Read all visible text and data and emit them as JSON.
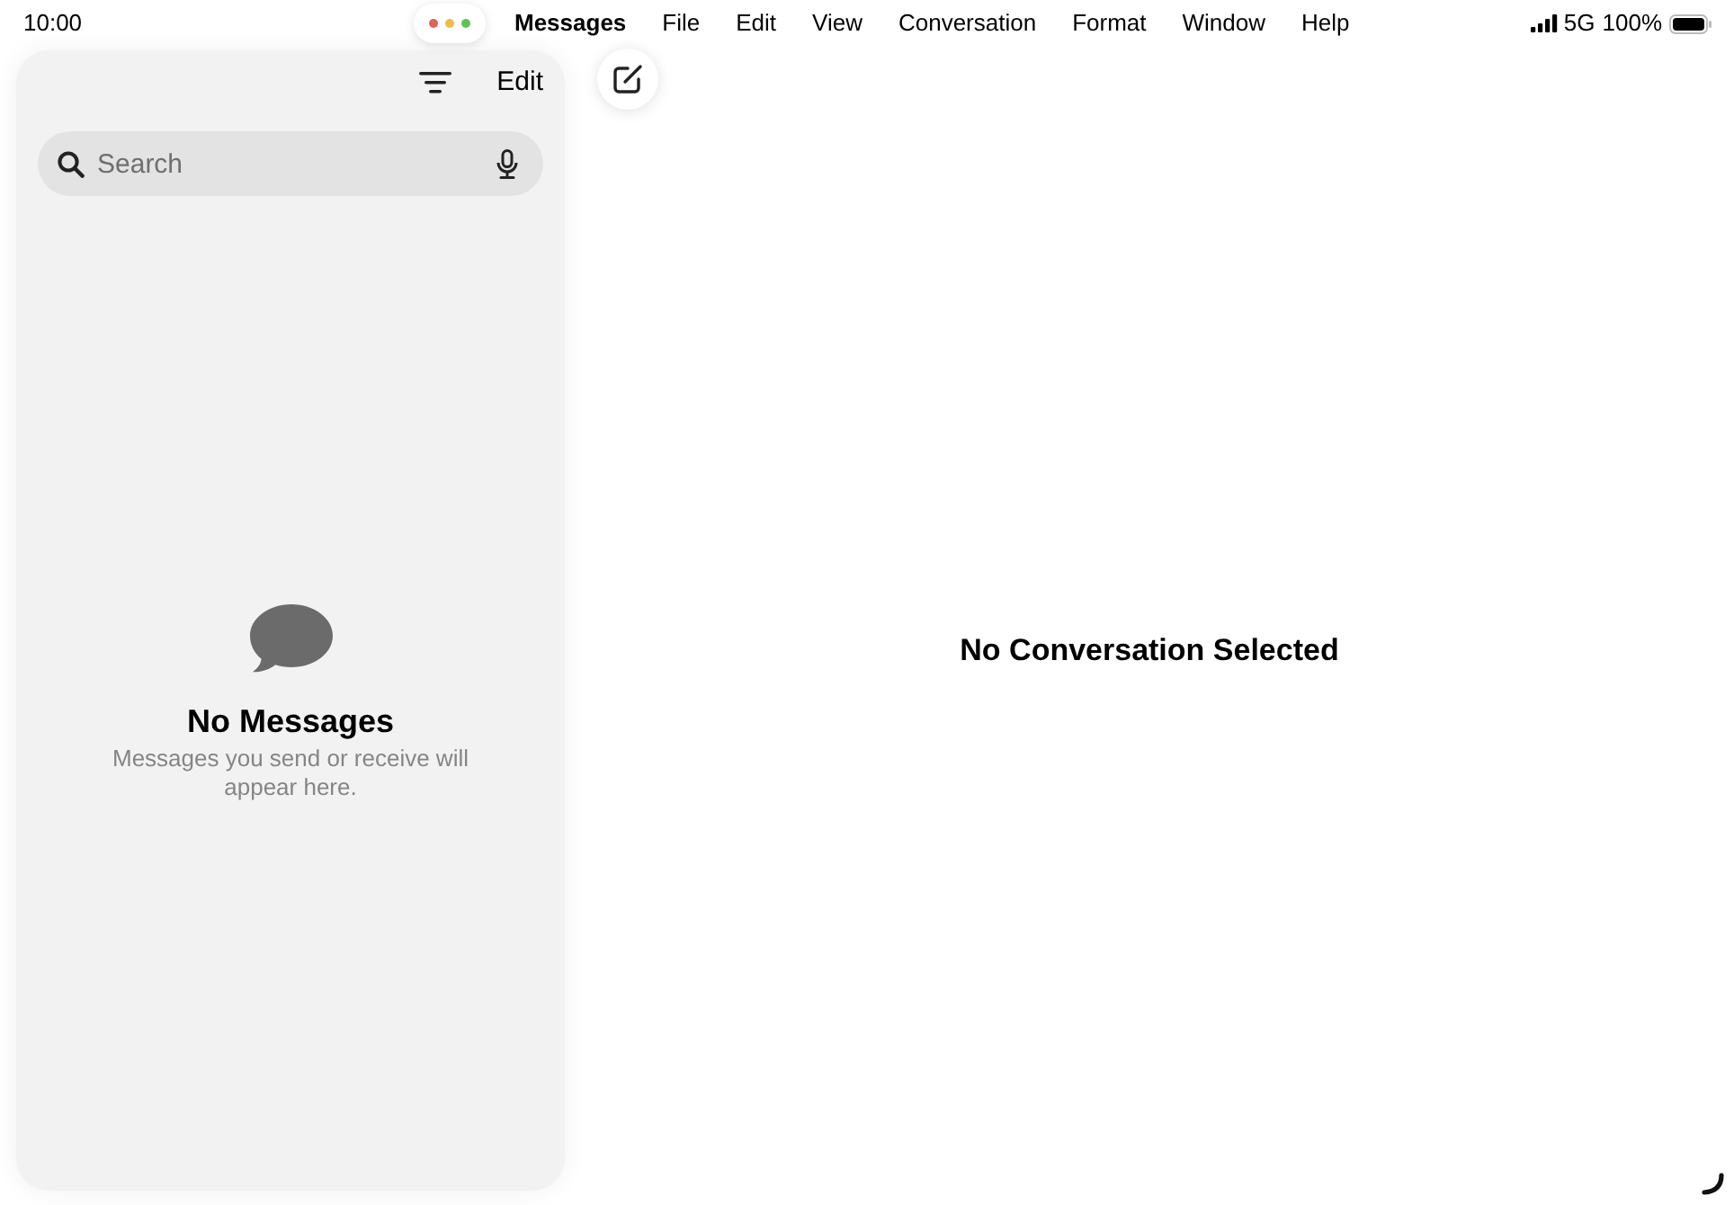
{
  "status_bar": {
    "time": "10:00",
    "network": "5G",
    "battery": "100%"
  },
  "menu_bar": {
    "app_name": "Messages",
    "items": [
      "File",
      "Edit",
      "View",
      "Conversation",
      "Format",
      "Window",
      "Help"
    ]
  },
  "sidebar": {
    "edit_button": "Edit",
    "search": {
      "placeholder": "Search"
    },
    "empty_state": {
      "title": "No Messages",
      "message": "Messages you send or receive will appear here."
    }
  },
  "detail": {
    "message": "No Conversation Selected"
  }
}
